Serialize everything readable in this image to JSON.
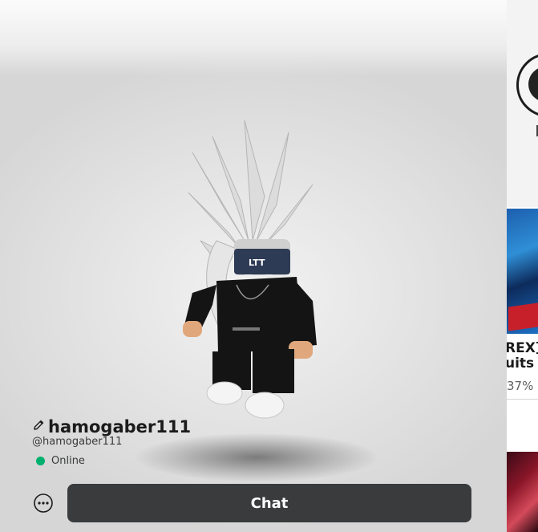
{
  "profile": {
    "display_name": "hamogaber111",
    "username": "@hamogaber111",
    "status": "Online",
    "status_color": "#00b06f"
  },
  "actions": {
    "chat_label": "Chat",
    "more_icon": "more-options-icon",
    "edit_icon": "pencil-icon"
  },
  "right_panel": {
    "game_title_line1": "REX]",
    "game_title_line2": "uits B",
    "game_rating": "37%"
  },
  "colors": {
    "button_bg": "#393b3d",
    "text_primary": "#1b1b1b"
  }
}
